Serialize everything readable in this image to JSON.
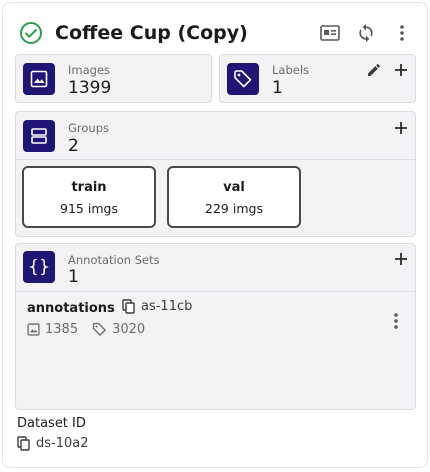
{
  "header": {
    "title": "Coffee Cup (Copy)",
    "status_color": "#2e9e49",
    "actions": [
      "preview-icon",
      "refresh-icon",
      "more-vertical-icon"
    ]
  },
  "images": {
    "label": "Images",
    "value": "1399",
    "icon": "image-icon"
  },
  "labels": {
    "label": "Labels",
    "value": "1",
    "icon": "tag-icon",
    "actions": [
      "edit-icon",
      "add-icon"
    ]
  },
  "groups": {
    "label": "Groups",
    "value": "2",
    "icon": "groups-icon",
    "items": [
      {
        "name": "train",
        "count": "915 imgs"
      },
      {
        "name": "val",
        "count": "229 imgs"
      }
    ]
  },
  "annotation_sets": {
    "label": "Annotation Sets",
    "value": "1",
    "icon": "braces-icon",
    "items": [
      {
        "name": "annotations",
        "id": "as-11cb",
        "images": "1385",
        "labels": "3020"
      }
    ]
  },
  "dataset": {
    "label": "Dataset ID",
    "id": "ds-10a2"
  },
  "colors": {
    "accent": "#1f1574",
    "card_bg": "#f3f3f5",
    "border": "#dcdce0"
  }
}
